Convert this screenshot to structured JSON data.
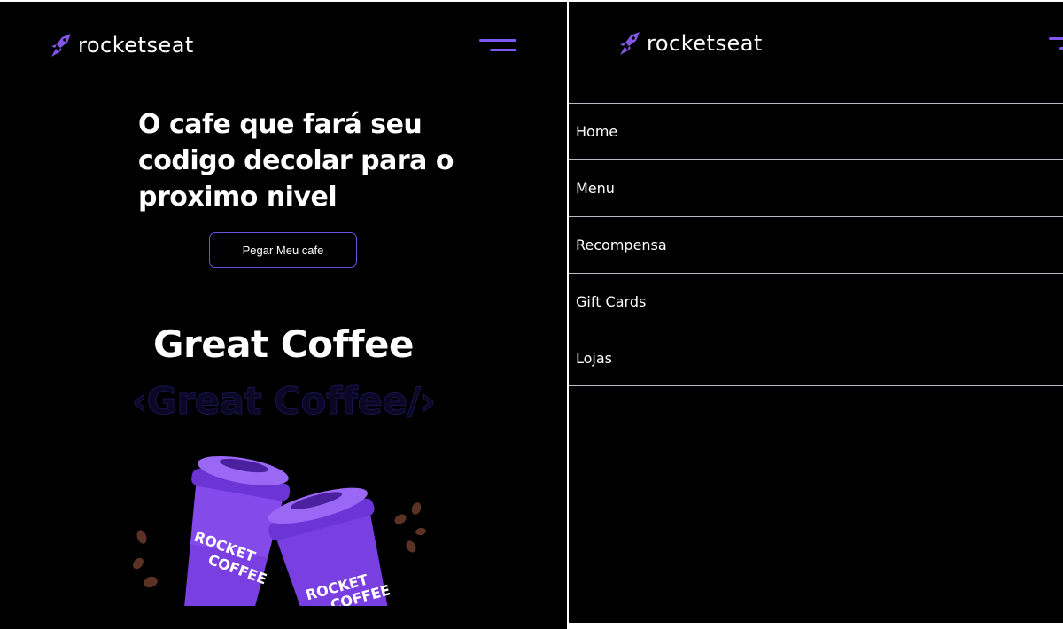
{
  "brand": {
    "name": "rocketseat"
  },
  "hero": {
    "title": "O cafe que fará seu codigo decolar para o proximo nivel",
    "cta_label": "Pegar Meu cafe"
  },
  "section": {
    "title": "Great Coffee",
    "outline_title": "‹Great Coffee/›"
  },
  "illustration": {
    "cup_text_1": "ROCKET",
    "cup_text_2": "COFFEE"
  },
  "menu": {
    "items": [
      {
        "label": "Home"
      },
      {
        "label": "Menu"
      },
      {
        "label": "Recompensa"
      },
      {
        "label": "Gift Cards"
      },
      {
        "label": "Lojas"
      }
    ]
  },
  "colors": {
    "background": "#000000",
    "accent": "#7f57f1",
    "button_border": "#6c4fd8",
    "divider": "#b8b8c8"
  },
  "icons": {
    "menu": "hamburger-icon",
    "logo": "rocket-logo-icon"
  }
}
